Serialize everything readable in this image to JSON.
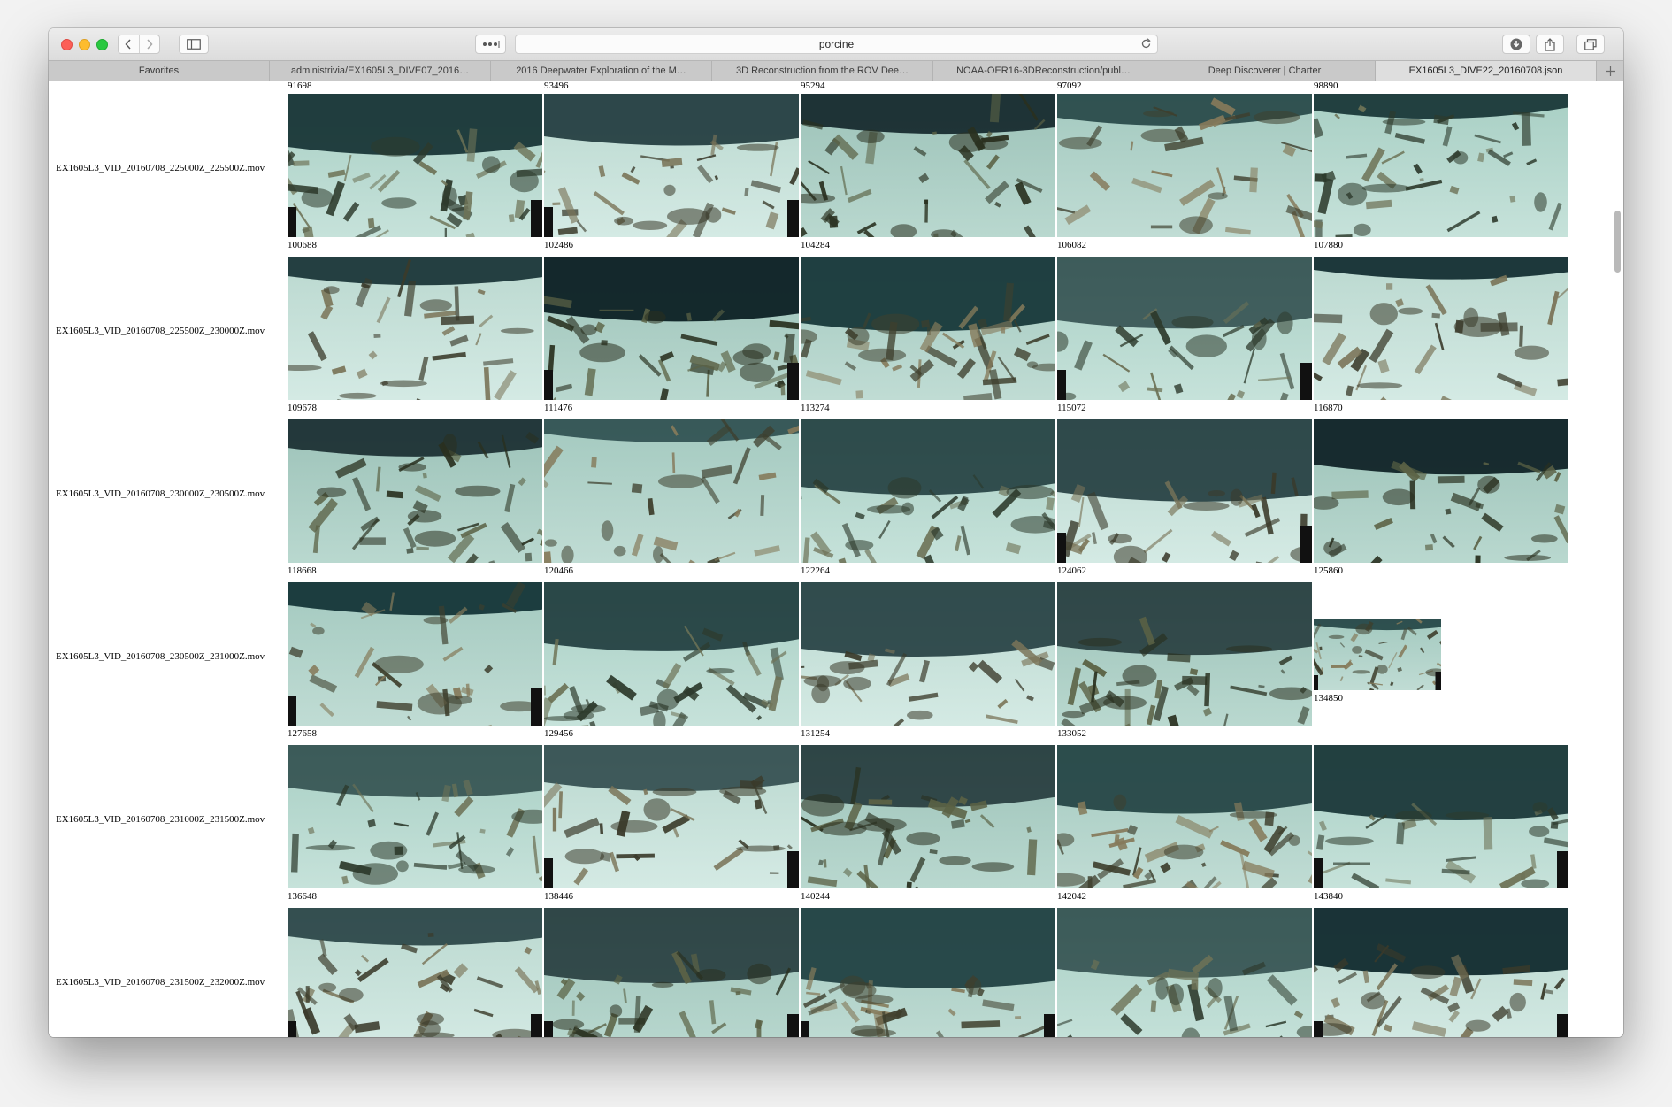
{
  "browser": {
    "url": "porcine",
    "tabs": [
      {
        "label": "Favorites",
        "active": false
      },
      {
        "label": "administrivia/EX1605L3_DIVE07_2016…",
        "active": false
      },
      {
        "label": "2016 Deepwater Exploration of the M…",
        "active": false
      },
      {
        "label": "3D Reconstruction from the ROV Dee…",
        "active": false
      },
      {
        "label": "NOAA-OER16-3DReconstruction/publ…",
        "active": false
      },
      {
        "label": "Deep Discoverer | Charter",
        "active": false
      },
      {
        "label": "EX1605L3_DIVE22_20160708.json",
        "active": true
      }
    ],
    "icons": {
      "back": "chevron-left-icon",
      "forward": "chevron-right-icon",
      "sidebar": "sidebar-icon",
      "reader": "dots-icon",
      "reload": "reload-icon",
      "download": "download-icon",
      "share": "share-icon",
      "tabs": "tabs-overview-icon",
      "new_tab": "plus-icon"
    }
  },
  "gallery": {
    "top_captions": [
      "91698",
      "93496",
      "95294",
      "97092",
      "98890"
    ],
    "rows": [
      {
        "file": "EX1605L3_VID_20160708_225000Z_225500Z.mov",
        "frames": [
          "100688",
          "102486",
          "104284",
          "106082",
          "107880"
        ]
      },
      {
        "file": "EX1605L3_VID_20160708_225500Z_230000Z.mov",
        "frames": [
          "109678",
          "111476",
          "113274",
          "115072",
          "116870"
        ]
      },
      {
        "file": "EX1605L3_VID_20160708_230000Z_230500Z.mov",
        "frames": [
          "118668",
          "120466",
          "122264",
          "124062",
          "125860"
        ]
      },
      {
        "file": "EX1605L3_VID_20160708_230500Z_231000Z.mov",
        "frames": [
          "127658",
          "129456",
          "131254",
          "133052",
          "134850"
        ]
      },
      {
        "file": "EX1605L3_VID_20160708_231000Z_231500Z.mov",
        "frames": [
          "136648",
          "138446",
          "140244",
          "142042",
          "143840"
        ]
      },
      {
        "file": "EX1605L3_VID_20160708_231500Z_232000Z.mov",
        "frames": [
          "",
          "",
          "",
          "",
          ""
        ]
      }
    ]
  }
}
